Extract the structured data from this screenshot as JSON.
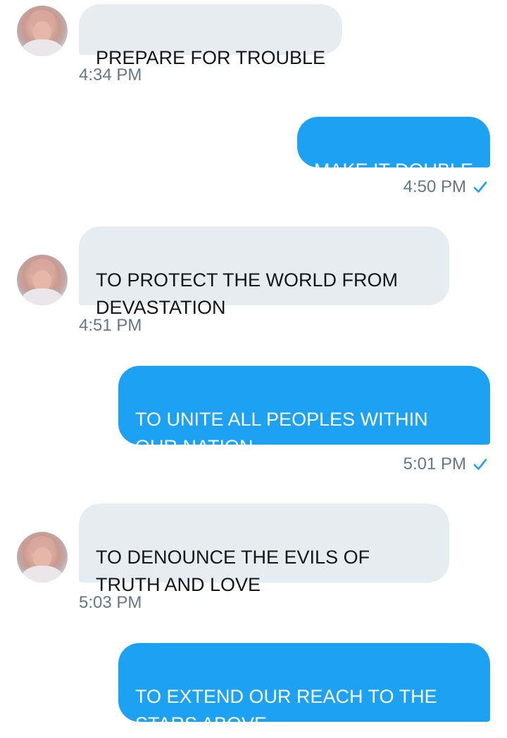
{
  "messages": [
    {
      "text": "PREPARE FOR TROUBLE",
      "time": "4:34 PM"
    },
    {
      "text": "MAKE IT DOUBLE",
      "time": "4:50 PM"
    },
    {
      "text": "TO PROTECT THE WORLD FROM\nDEVASTATION",
      "time": "4:51 PM"
    },
    {
      "text": "TO UNITE ALL PEOPLES WITHIN\nOUR NATION",
      "time": "5:01 PM"
    },
    {
      "text": "TO DENOUNCE THE EVILS OF\nTRUTH AND LOVE",
      "time": "5:03 PM"
    },
    {
      "text": "TO EXTEND OUR REACH TO THE\nSTARS ABOVE"
    }
  ],
  "colors": {
    "incoming_bubble": "#e6ecf0",
    "outgoing_bubble": "#1da1f2",
    "timestamp": "#657786",
    "read_check": "#1da1f2"
  },
  "icons": {
    "read_receipt": "checkmark-icon",
    "sender_avatar": "avatar"
  }
}
